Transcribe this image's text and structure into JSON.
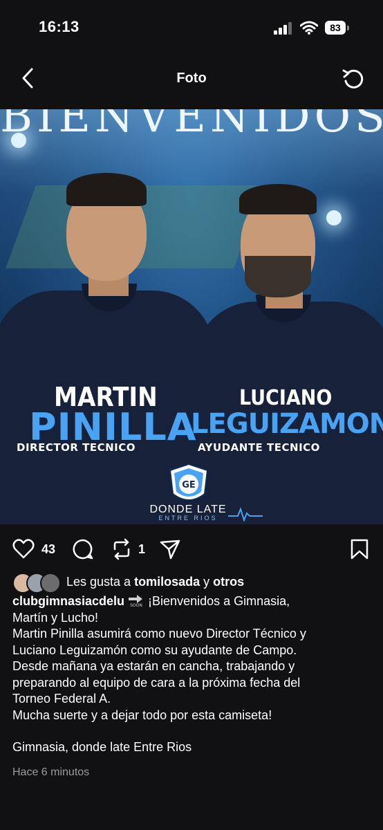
{
  "status_bar": {
    "time": "16:13",
    "battery": "83"
  },
  "nav": {
    "title": "Foto"
  },
  "photo": {
    "banner": "BIENVENIDOS",
    "left_person": {
      "first": "MARTIN",
      "last": "PINILLA",
      "role": "DIRECTOR TECNICO"
    },
    "right_person": {
      "first": "LUCIANO",
      "last": "LEGUIZAMON",
      "role": "AYUDANTE TECNICO"
    },
    "crest_letters": "GE",
    "brand": "DONDE LATE",
    "brand_sub": "ENTRE RIOS"
  },
  "actions": {
    "likes_count": "43",
    "reposts_count": "1"
  },
  "likes_line": {
    "prefix": "Les gusta a ",
    "user": "tomilosada",
    "joiner": " y ",
    "others": "otros"
  },
  "caption": {
    "username": "clubgimnasiacdelu",
    "emoji": "soon-arrow-icon",
    "first_line": "¡Bienvenidos a Gimnasia,",
    "lines": [
      "Martín y Lucho!",
      "Martin Pinilla asumirá como nuevo Director Técnico y",
      "Luciano Leguizamón como su ayudante de Campo.",
      "Desde mañana ya estarán en cancha, trabajando y",
      "preparando al equipo de cara a la próxima fecha del",
      "Torneo Federal A.",
      "Mucha suerte y a dejar todo por esta camiseta!"
    ],
    "signature": "Gimnasia, donde late Entre Rios"
  },
  "time_ago": "Hace 6 minutos",
  "colors": {
    "background": "#111114",
    "accent_blue": "#4aa3f2",
    "muted": "#9a9aa0"
  }
}
